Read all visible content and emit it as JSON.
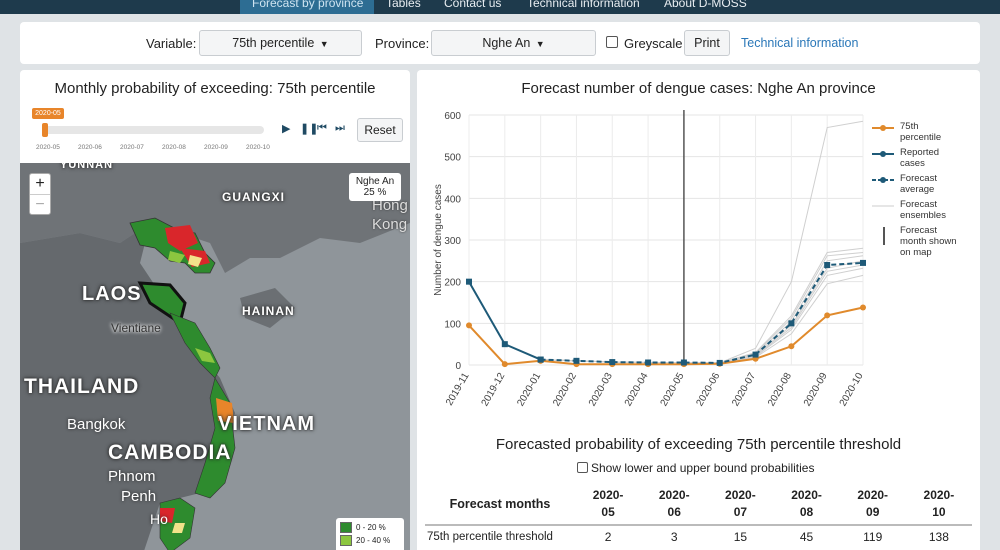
{
  "nav": {
    "tabs": [
      {
        "label": "Forecast by province",
        "active": true
      },
      {
        "label": "Tables",
        "active": false
      },
      {
        "label": "Contact us",
        "active": false
      },
      {
        "label": "Technical information",
        "active": false
      },
      {
        "label": "About D-MOSS",
        "active": false
      }
    ]
  },
  "controls": {
    "variable_label": "Variable:",
    "variable_value": "75th percentile",
    "province_label": "Province:",
    "province_value": "Nghe An",
    "greyscale_label": "Greyscale",
    "greyscale_checked": false,
    "print_label": "Print",
    "tech_info_link": "Technical information"
  },
  "left_panel": {
    "title": "Monthly probability of exceeding: 75th percentile",
    "slider": {
      "current": "2020-05",
      "ticks": [
        "2020-05",
        "2020-06",
        "2020-07",
        "2020-08",
        "2020-09",
        "2020-10"
      ]
    },
    "reset_label": "Reset",
    "map": {
      "labels": {
        "yunnan": "YUNNAN",
        "guangxi": "GUANGXI",
        "hong": "Hong",
        "kong": "Kong",
        "laos": "LAOS",
        "vientiane": "Vientiane",
        "hainan": "HAINAN",
        "thailand": "THAILAND",
        "bangkok": "Bangkok",
        "cambodia": "CAMBODIA",
        "vietnam": "VIETNAM",
        "phnom": "Phnom",
        "penh": "Penh",
        "ho": "Ho"
      },
      "infobox": {
        "province": "Nghe An",
        "value": "25 %"
      },
      "zoom_in": "+",
      "zoom_out": "−",
      "legend": [
        {
          "label": "0 - 20 %",
          "color": "#2e8b2e"
        },
        {
          "label": "20 - 40 %",
          "color": "#8cc63f"
        }
      ]
    }
  },
  "chart": {
    "title": "Forecast number of dengue cases: Nghe An province",
    "ylabel": "Number of dengue cases",
    "legend": [
      {
        "label": "75th percentile",
        "color": "#e08a2c"
      },
      {
        "label": "Reported cases",
        "color": "#1e5a78"
      },
      {
        "label": "Forecast average",
        "color": "#1e5a78"
      },
      {
        "label": "Forecast ensembles",
        "color": "#cccccc"
      },
      {
        "label": "Forecast month shown on map",
        "color": "#555555"
      }
    ]
  },
  "chart_data": {
    "type": "line",
    "title": "Forecast number of dengue cases: Nghe An province",
    "xlabel": "",
    "ylabel": "Number of dengue cases",
    "x": [
      "2019-11",
      "2019-12",
      "2020-01",
      "2020-02",
      "2020-03",
      "2020-04",
      "2020-05",
      "2020-06",
      "2020-07",
      "2020-08",
      "2020-09",
      "2020-10"
    ],
    "ylim": [
      0,
      600
    ],
    "yticks": [
      0,
      100,
      200,
      300,
      400,
      500,
      600
    ],
    "series": [
      {
        "name": "75th percentile",
        "color": "#e08a2c",
        "values": [
          95,
          2,
          10,
          2,
          2,
          2,
          2,
          3,
          15,
          45,
          119,
          138
        ]
      },
      {
        "name": "Reported cases",
        "color": "#1e5a78",
        "values": [
          200,
          50,
          13,
          null,
          null,
          null,
          null,
          null,
          null,
          null,
          null,
          null
        ]
      },
      {
        "name": "Forecast average",
        "color": "#1e5a78",
        "values": [
          null,
          null,
          13,
          10,
          7,
          6,
          6,
          5,
          25,
          100,
          240,
          245
        ]
      },
      {
        "name": "Forecast ensembles",
        "color": "#cfcfcf",
        "ensemble": [
          [
            null,
            null,
            13,
            10,
            7,
            6,
            6,
            5,
            18,
            75,
            195,
            215
          ],
          [
            null,
            null,
            13,
            10,
            7,
            6,
            6,
            5,
            20,
            85,
            215,
            232
          ],
          [
            null,
            null,
            13,
            10,
            7,
            6,
            6,
            5,
            22,
            90,
            225,
            240
          ],
          [
            null,
            null,
            13,
            10,
            7,
            6,
            6,
            5,
            24,
            95,
            232,
            250
          ],
          [
            null,
            null,
            13,
            10,
            7,
            6,
            6,
            5,
            26,
            105,
            250,
            262
          ],
          [
            null,
            null,
            13,
            10,
            7,
            6,
            6,
            5,
            28,
            112,
            262,
            270
          ],
          [
            null,
            null,
            13,
            10,
            7,
            6,
            6,
            5,
            30,
            118,
            270,
            280
          ],
          [
            null,
            null,
            13,
            10,
            7,
            6,
            6,
            5,
            40,
            200,
            570,
            585
          ]
        ]
      }
    ],
    "vline_at": "2020-05",
    "grid": true,
    "legend_position": "right"
  },
  "table": {
    "title": "Forecasted probability of exceeding 75th percentile threshold",
    "show_bounds_label": "Show lower and upper bound probabilities",
    "header_first": "Forecast months",
    "months": [
      {
        "year": "2020-",
        "month": "05"
      },
      {
        "year": "2020-",
        "month": "06"
      },
      {
        "year": "2020-",
        "month": "07"
      },
      {
        "year": "2020-",
        "month": "08"
      },
      {
        "year": "2020-",
        "month": "09"
      },
      {
        "year": "2020-",
        "month": "10"
      }
    ],
    "row_label": "75th percentile threshold",
    "values": [
      "2",
      "3",
      "15",
      "45",
      "119",
      "138"
    ]
  }
}
